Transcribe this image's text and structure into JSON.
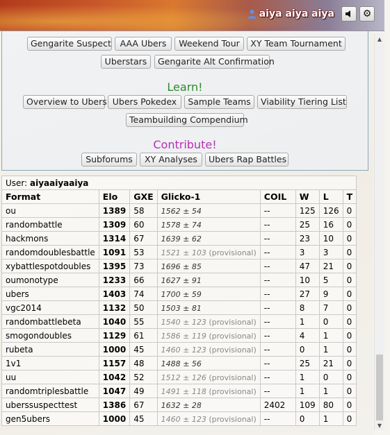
{
  "header": {
    "username": "aiya aiya aiya",
    "sound_icon": "speaker-icon",
    "settings_icon": "gear-icon"
  },
  "forum_links": {
    "top_row": [
      "Gengarite Suspect",
      "AAA Ubers",
      "Weekend Tour",
      "XY Team Tournament"
    ],
    "second_row": [
      "Uberstars",
      "Gengarite Alt Confirmation"
    ],
    "learn_title": "Learn!",
    "learn_row1": [
      "Overview to Ubers",
      "Ubers Pokedex",
      "Sample Teams",
      "Viability Tiering List"
    ],
    "learn_row2": [
      "Teambuilding Compendium"
    ],
    "contribute_title": "Contribute!",
    "contribute_row": [
      "Subforums",
      "XY Analyses",
      "Ubers Rap Battles"
    ]
  },
  "ladder": {
    "user_label": "User: ",
    "user_name": "aiyaaiyaaiya",
    "columns": [
      "Format",
      "Elo",
      "GXE",
      "Glicko-1",
      "COIL",
      "W",
      "L",
      "T"
    ],
    "rows": [
      {
        "format": "ou",
        "elo": "1389",
        "gxe": "58",
        "glicko": "1562 ± 54",
        "prov": "",
        "coil": "--",
        "w": "125",
        "l": "126",
        "t": "0"
      },
      {
        "format": "randombattle",
        "elo": "1309",
        "gxe": "60",
        "glicko": "1578 ± 74",
        "prov": "",
        "coil": "--",
        "w": "25",
        "l": "16",
        "t": "0"
      },
      {
        "format": "hackmons",
        "elo": "1314",
        "gxe": "67",
        "glicko": "1639 ± 62",
        "prov": "",
        "coil": "--",
        "w": "23",
        "l": "10",
        "t": "0"
      },
      {
        "format": "randomdoublesbattle",
        "elo": "1091",
        "gxe": "53",
        "glicko": "1521 ± 103",
        "prov": " (provisional)",
        "coil": "--",
        "w": "3",
        "l": "3",
        "t": "0"
      },
      {
        "format": "xybattlespotdoubles",
        "elo": "1395",
        "gxe": "73",
        "glicko": "1696 ± 85",
        "prov": "",
        "coil": "--",
        "w": "47",
        "l": "21",
        "t": "0"
      },
      {
        "format": "oumonotype",
        "elo": "1233",
        "gxe": "66",
        "glicko": "1627 ± 91",
        "prov": "",
        "coil": "--",
        "w": "10",
        "l": "5",
        "t": "0"
      },
      {
        "format": "ubers",
        "elo": "1403",
        "gxe": "74",
        "glicko": "1700 ± 59",
        "prov": "",
        "coil": "--",
        "w": "27",
        "l": "9",
        "t": "0"
      },
      {
        "format": "vgc2014",
        "elo": "1132",
        "gxe": "50",
        "glicko": "1503 ± 81",
        "prov": "",
        "coil": "--",
        "w": "8",
        "l": "7",
        "t": "0"
      },
      {
        "format": "randombattlebeta",
        "elo": "1040",
        "gxe": "55",
        "glicko": "1540 ± 123",
        "prov": " (provisional)",
        "coil": "--",
        "w": "1",
        "l": "0",
        "t": "0"
      },
      {
        "format": "smogondoubles",
        "elo": "1129",
        "gxe": "61",
        "glicko": "1586 ± 119",
        "prov": " (provisional)",
        "coil": "--",
        "w": "4",
        "l": "1",
        "t": "0"
      },
      {
        "format": "rubeta",
        "elo": "1000",
        "gxe": "45",
        "glicko": "1460 ± 123",
        "prov": " (provisional)",
        "coil": "--",
        "w": "0",
        "l": "1",
        "t": "0"
      },
      {
        "format": "1v1",
        "elo": "1157",
        "gxe": "48",
        "glicko": "1488 ± 56",
        "prov": "",
        "coil": "--",
        "w": "25",
        "l": "21",
        "t": "0"
      },
      {
        "format": "uu",
        "elo": "1042",
        "gxe": "52",
        "glicko": "1512 ± 126",
        "prov": " (provisional)",
        "coil": "--",
        "w": "1",
        "l": "0",
        "t": "0"
      },
      {
        "format": "randomtriplesbattle",
        "elo": "1047",
        "gxe": "49",
        "glicko": "1491 ± 118",
        "prov": " (provisional)",
        "coil": "--",
        "w": "1",
        "l": "1",
        "t": "0"
      },
      {
        "format": "uberssuspecttest",
        "elo": "1386",
        "gxe": "67",
        "glicko": "1632 ± 28",
        "prov": "",
        "coil": "2402",
        "w": "109",
        "l": "80",
        "t": "0"
      },
      {
        "format": "gen5ubers",
        "elo": "1000",
        "gxe": "45",
        "glicko": "1460 ± 123",
        "prov": " (provisional)",
        "coil": "--",
        "w": "0",
        "l": "1",
        "t": "0"
      }
    ]
  }
}
